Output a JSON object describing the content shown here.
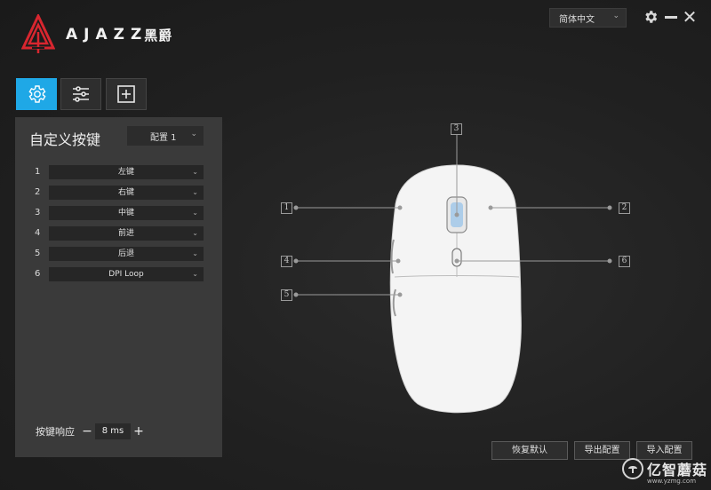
{
  "app": {
    "brand_latin": "AJAZZ",
    "brand_cn": "黑爵",
    "accent_color": "#1fa8e6",
    "logo_color": "#d8262f"
  },
  "window": {
    "language": "简体中文",
    "settings_icon": "gear-icon",
    "minimize_icon": "minimize-icon",
    "close_icon": "close-icon"
  },
  "toolbar": {
    "tabs": [
      {
        "icon": "gear-icon",
        "active": true
      },
      {
        "icon": "sliders-icon",
        "active": false
      },
      {
        "icon": "plus-box-icon",
        "active": false
      }
    ]
  },
  "panel": {
    "title": "自定义按键",
    "profile": "配置 1",
    "keys": [
      {
        "num": "1",
        "value": "左键"
      },
      {
        "num": "2",
        "value": "右键"
      },
      {
        "num": "3",
        "value": "中键"
      },
      {
        "num": "4",
        "value": "前进"
      },
      {
        "num": "5",
        "value": "后退"
      },
      {
        "num": "6",
        "value": "DPI Loop"
      }
    ],
    "latency_label": "按键响应",
    "latency_value": "8 ms",
    "latency_minus": "−",
    "latency_plus": "+"
  },
  "diagram": {
    "callouts": [
      "1",
      "2",
      "3",
      "4",
      "5",
      "6"
    ]
  },
  "actions": {
    "restore": "恢复默认",
    "export": "导出配置",
    "import": "导入配置"
  },
  "watermark": {
    "text": "亿智蘑菇",
    "url": "www.yzmg.com"
  }
}
